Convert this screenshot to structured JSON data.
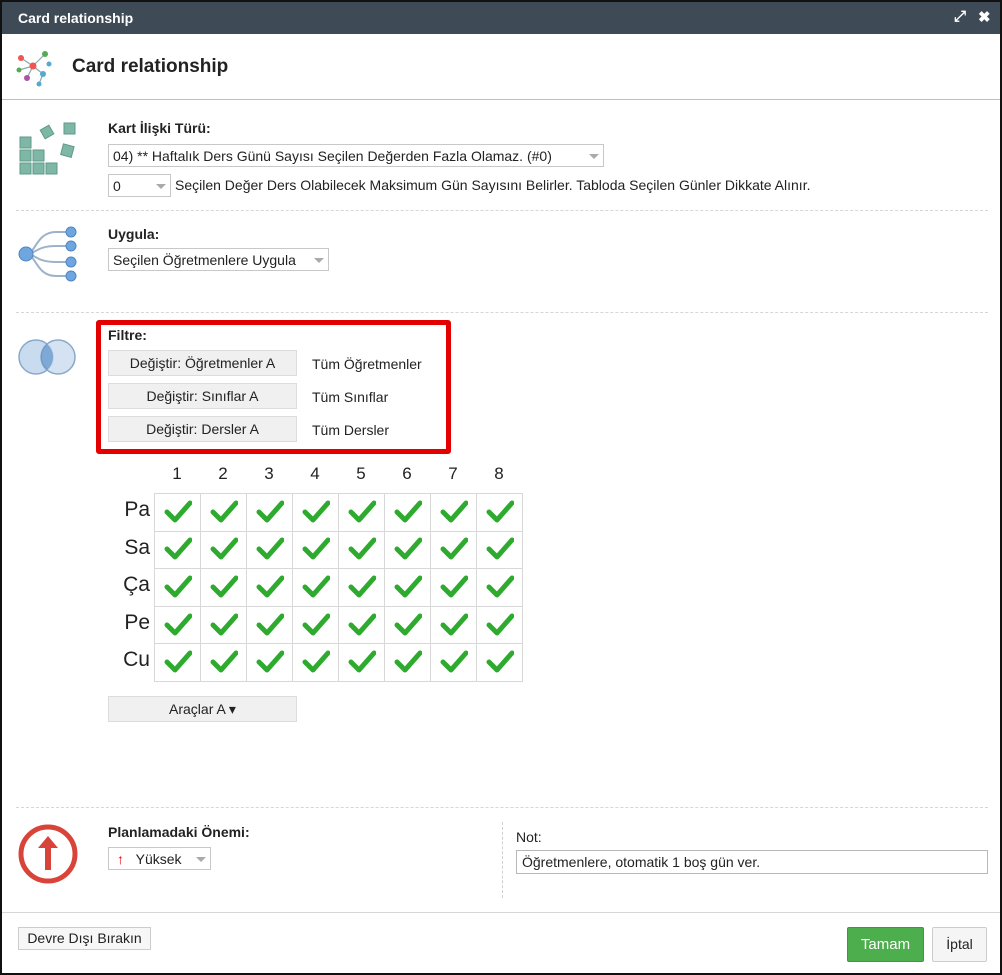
{
  "window": {
    "title": "Card relationship",
    "expand_icon": "expand-icon",
    "close_icon": "close-icon"
  },
  "header": {
    "title": "Card relationship",
    "icon": "network-icon"
  },
  "relation_type": {
    "label": "Kart İlişki Türü:",
    "selected": "04) ** Haftalık Ders Günü Sayısı Seçilen Değerden Fazla Olamaz. (#0)",
    "value_selected": "0",
    "description": "Seçilen Değer Ders Olabilecek Maksimum Gün Sayısını Belirler. Tabloda Seçilen Günler Dikkate Alınır."
  },
  "apply": {
    "label": "Uygula:",
    "selected": "Seçilen Öğretmenlere Uygula"
  },
  "filter": {
    "label": "Filtre:",
    "rows": [
      {
        "button": "Değiştir: Öğretmenler A",
        "value": "Tüm Öğretmenler"
      },
      {
        "button": "Değiştir: Sınıflar A",
        "value": "Tüm Sınıflar"
      },
      {
        "button": "Değiştir: Dersler A",
        "value": "Tüm Dersler"
      }
    ],
    "highlight_color": "#e50000"
  },
  "schedule": {
    "columns": [
      "1",
      "2",
      "3",
      "4",
      "5",
      "6",
      "7",
      "8"
    ],
    "rows": [
      "Pa",
      "Sa",
      "Ça",
      "Pe",
      "Cu"
    ],
    "all_checked": true,
    "check_color": "#2eaa2e"
  },
  "tools_button": "Araçlar A ▾",
  "importance": {
    "label": "Planlamadaki Önemi:",
    "selected": "Yüksek",
    "icon": "arrow-up-icon"
  },
  "note": {
    "label": "Not:",
    "value": "Öğretmenlere, otomatik 1 boş gün ver."
  },
  "footer": {
    "disable_button": "Devre Dışı Bırakın",
    "ok_button": "Tamam",
    "cancel_button": "İptal",
    "ok_color": "#4cae4c"
  }
}
